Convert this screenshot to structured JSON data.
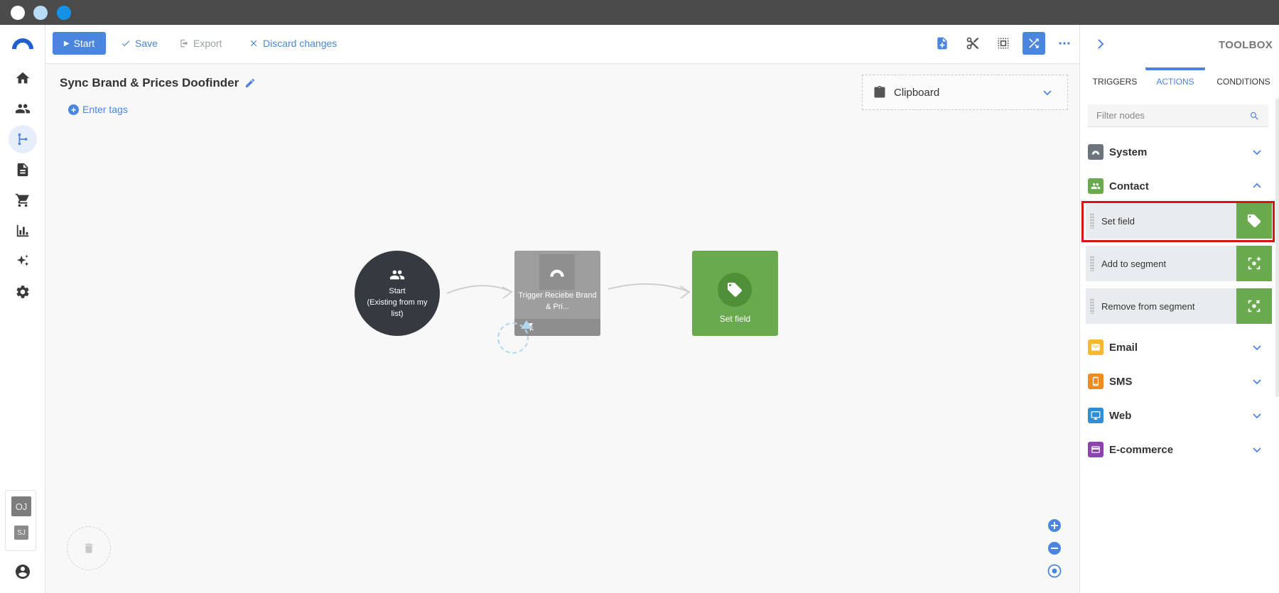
{
  "toolbar": {
    "start_label": "Start",
    "save_label": "Save",
    "export_label": "Export",
    "discard_label": "Discard changes"
  },
  "user": {
    "primary_initials": "OJ",
    "secondary_initials": "SJ"
  },
  "flow": {
    "title": "Sync Brand & Prices Doofinder",
    "tags_label": "Enter tags",
    "clipboard_label": "Clipboard",
    "nodes": {
      "start_line1": "Start",
      "start_line2": "(Existing from my list)",
      "trigger_label": "Trigger Reciebe Brand & Pri...",
      "setfield_label": "Set field"
    }
  },
  "toolbox": {
    "title": "TOOLBOX",
    "tabs": [
      "TRIGGERS",
      "ACTIONS",
      "CONDITIONS"
    ],
    "active_tab": "ACTIONS",
    "filter_placeholder": "Filter nodes",
    "categories": [
      {
        "name": "System",
        "color": "#6c757d",
        "expanded": false
      },
      {
        "name": "Contact",
        "color": "#6aaa4f",
        "expanded": true
      },
      {
        "name": "Email",
        "color": "#f5b82e",
        "expanded": false
      },
      {
        "name": "SMS",
        "color": "#f08b1f",
        "expanded": false
      },
      {
        "name": "Web",
        "color": "#2f8ed8",
        "expanded": false
      },
      {
        "name": "E-commerce",
        "color": "#8e44ad",
        "expanded": false
      }
    ],
    "contact_actions": [
      {
        "label": "Set field",
        "icon": "tag-icon"
      },
      {
        "label": "Add to segment",
        "icon": "segment-add-icon"
      },
      {
        "label": "Remove from segment",
        "icon": "segment-remove-icon"
      }
    ]
  },
  "colors": {
    "accent": "#4a86e0",
    "contact_green": "#6aaa4f",
    "highlight": "#d6141a"
  }
}
